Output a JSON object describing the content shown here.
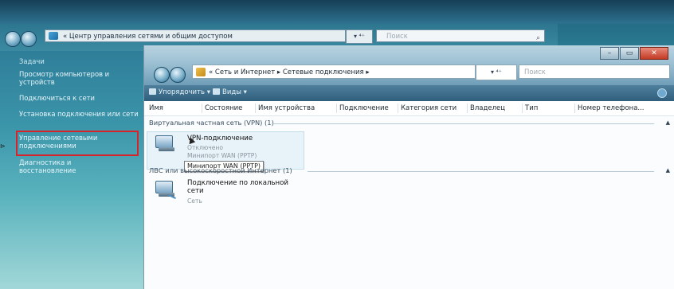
{
  "background_window": {
    "address_path": "« Центр управления сетями и общим доступом",
    "search_placeholder": "Поиск",
    "tasks_header": "Задачи",
    "tasks": [
      "Просмотр компьютеров и устройств",
      "Подключиться к сети",
      "Установка подключения или сети",
      "Управление сетевыми подключениями",
      "Диагностика и восстановление"
    ]
  },
  "window": {
    "address_path": "« Сеть и Интернет ▸ Сетевые подключения ▸",
    "search_placeholder": "Поиск",
    "toolbar": {
      "organize": "Упорядочить",
      "views": "Виды"
    },
    "columns": [
      "Имя",
      "Состояние",
      "Имя устройства",
      "Подключение",
      "Категория сети",
      "Владелец",
      "Тип",
      "Номер телефона..."
    ],
    "groups": [
      {
        "title": "Виртуальная частная сеть (VPN) (1)",
        "items": [
          {
            "name": "VPN-подключение",
            "status": "Отключено",
            "device": "Минипорт WAN (PPTP)"
          }
        ]
      },
      {
        "title": "ЛВС или высокоскоростной Интернет (1)",
        "items": [
          {
            "name": "Подключение по локальной сети",
            "status": "Сеть"
          }
        ]
      }
    ],
    "tooltip": "Минипорт WAN (PPTP)"
  },
  "colors": {
    "highlight_border": "#d8232a",
    "toolbar": "#3f6f8c"
  }
}
